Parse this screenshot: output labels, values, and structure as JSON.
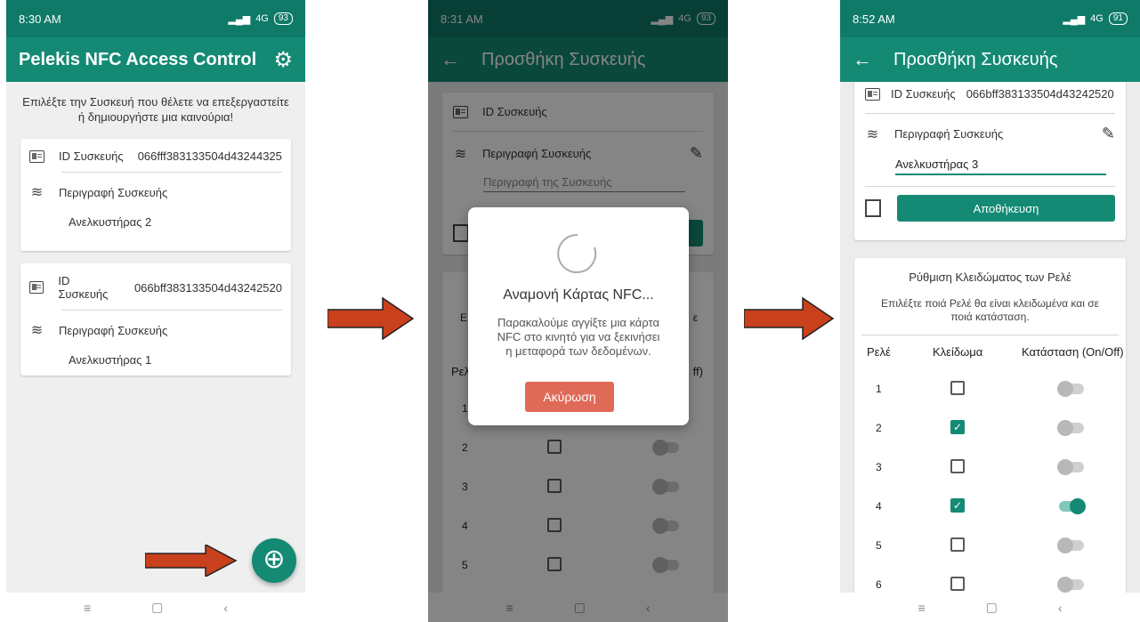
{
  "screen1": {
    "time": "8:30 AM",
    "network": "4G",
    "battery": "93",
    "title": "Pelekis NFC Access Control",
    "intro": "Επιλέξτε την Συσκευή που θέλετε να επεξεργαστείτε ή δημιουργήστε μια καινούρια!",
    "devices": [
      {
        "id_label": "ID Συσκευής",
        "id_value": "066fff383133504d43244325",
        "desc_label": "Περιγραφή Συσκευής",
        "desc_value": "Ανελκυστήρας 2"
      },
      {
        "id_label": "ID Συσκευής",
        "id_value": "066bff383133504d43242520",
        "desc_label": "Περιγραφή Συσκευής",
        "desc_value": "Ανελκυστήρας 1"
      }
    ],
    "fab_icon": "add-icon"
  },
  "screen2": {
    "time": "8:31 AM",
    "network": "4G",
    "battery": "93",
    "title": "Προσθήκη Συσκευής",
    "id_label": "ID Συσκευής",
    "desc_label": "Περιγραφή Συσκευής",
    "desc_placeholder": "Περιγραφή της Συσκευής",
    "dialog": {
      "title": "Αναμονή Κάρτας NFC...",
      "message": "Παρακαλούμε αγγίξτε μια κάρτα NFC στο κινητό για να ξεκινήσει η μεταφορά των δεδομένων.",
      "cancel": "Ακύρωση"
    },
    "partial": {
      "left_e": "Ε",
      "right_e": "ε",
      "rele": "Ρελ",
      "off": "ff)"
    },
    "rows": [
      "1",
      "2",
      "3",
      "4",
      "5"
    ]
  },
  "screen3": {
    "time": "8:52 AM",
    "network": "4G",
    "battery": "91",
    "title": "Προσθήκη Συσκευής",
    "id_label": "ID Συσκευής",
    "id_value": "066bff383133504d43242520",
    "desc_label": "Περιγραφή Συσκευής",
    "desc_value": "Ανελκυστήρας 3",
    "save": "Αποθήκευση",
    "relay_title": "Ρύθμιση Κλειδώματος των Ρελέ",
    "relay_subtitle": "Επιλέξτε ποιά Ρελέ θα είναι κλειδωμένα και σε ποιά κατάσταση.",
    "columns": [
      "Ρελέ",
      "Κλείδωμα",
      "Κατάσταση (On/Off)"
    ],
    "relays": [
      {
        "num": "1",
        "locked": false,
        "on": false
      },
      {
        "num": "2",
        "locked": true,
        "on": false
      },
      {
        "num": "3",
        "locked": false,
        "on": false
      },
      {
        "num": "4",
        "locked": true,
        "on": true
      },
      {
        "num": "5",
        "locked": false,
        "on": false
      },
      {
        "num": "6",
        "locked": false,
        "on": false
      }
    ]
  },
  "colors": {
    "primary": "#148a74",
    "statusbar": "#0f7a68",
    "arrow": "#c8401c",
    "cancel": "#e06a58"
  }
}
